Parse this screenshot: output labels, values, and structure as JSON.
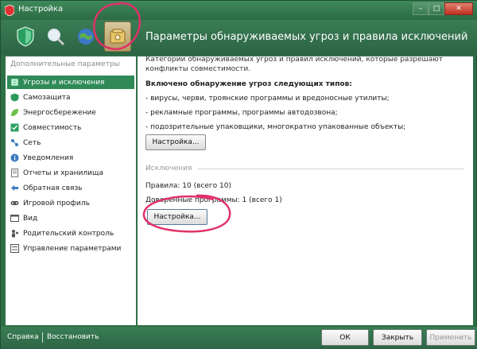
{
  "window": {
    "title": "Настройка",
    "min": "–",
    "max": "□",
    "close": "✕"
  },
  "toolbar": {
    "items": [
      {
        "icon": "shield-icon"
      },
      {
        "icon": "search-icon"
      },
      {
        "icon": "globe-icon"
      },
      {
        "icon": "safe-icon",
        "selected": true
      }
    ]
  },
  "section_title": "Параметры обнаруживаемых угроз и правила исключений",
  "sidebar": {
    "heading": "Дополнительные параметры",
    "items": [
      {
        "label": "Угрозы и исключения",
        "icon": "list-icon",
        "active": true
      },
      {
        "label": "Самозащита",
        "icon": "self-defense-icon"
      },
      {
        "label": "Энергосбережение",
        "icon": "leaf-icon"
      },
      {
        "label": "Совместимость",
        "icon": "check-icon"
      },
      {
        "label": "Сеть",
        "icon": "network-icon"
      },
      {
        "label": "Уведомления",
        "icon": "info-icon"
      },
      {
        "label": "Отчеты и хранилища",
        "icon": "report-icon"
      },
      {
        "label": "Обратная связь",
        "icon": "feedback-icon"
      },
      {
        "label": "Игровой профиль",
        "icon": "gamepad-icon"
      },
      {
        "label": "Вид",
        "icon": "view-icon"
      },
      {
        "label": "Родительский контроль",
        "icon": "parental-icon"
      },
      {
        "label": "Управление параметрами",
        "icon": "settings-icon"
      }
    ]
  },
  "content": {
    "description": "Категории обнаруживаемых угроз и правил исключений, которые разрешают конфликты совместимости.",
    "threats_heading": "Включено обнаружение угроз следующих типов:",
    "threats": [
      "- вирусы, черви, троянские программы и вредоносные утилиты;",
      "- рекламные программы, программы автодозвона;",
      "- подозрительные упаковщики, многократно упакованные объекты;"
    ],
    "threats_button": "Настройка...",
    "exclusions_label": "Исключения",
    "rules": "Правила: 10 (всего 10)",
    "trusted": "Доверенные программы: 1 (всего 1)",
    "exclusions_button": "Настройка..."
  },
  "footer": {
    "help": "Справка",
    "restore": "Восстановить",
    "ok": "ОК",
    "close": "Закрыть",
    "apply": "Применить"
  },
  "colors": {
    "accent": "#2f6f47",
    "active_item": "#2f8a57",
    "annotation": "#e0306a"
  }
}
